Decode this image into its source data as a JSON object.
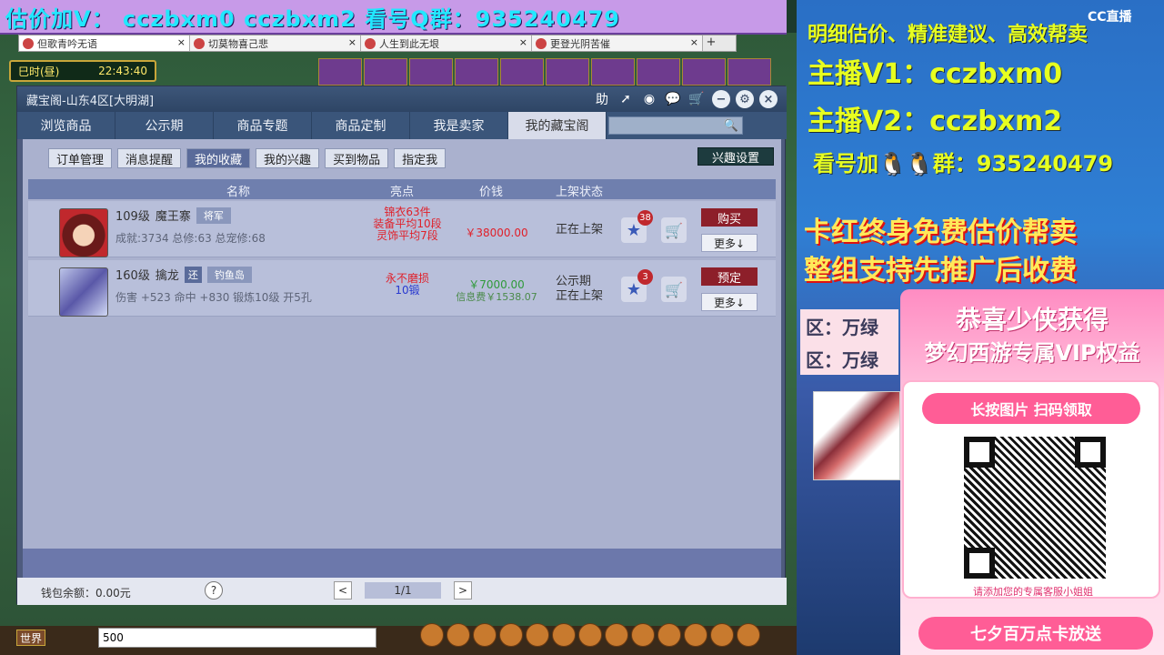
{
  "banner": {
    "text": "估价加V： cczbxm0  cczbxm2  看号Q群：935240479"
  },
  "game_tabs": [
    {
      "label": "但歌青吟无语"
    },
    {
      "label": "切莫物喜己悲"
    },
    {
      "label": "人生到此无垠"
    },
    {
      "label": "更登光阴苦催"
    }
  ],
  "add_tab": "+",
  "timebar": {
    "period": "巳时(昼)",
    "time": "22:43:40"
  },
  "window": {
    "title": "藏宝阁-山东4区[大明湖]",
    "help_label": "助",
    "nav_tabs": [
      "浏览商品",
      "公示期",
      "商品专题",
      "商品定制",
      "我是卖家",
      "我的藏宝阁"
    ],
    "sub_tabs": [
      "订单管理",
      "消息提醒",
      "我的收藏",
      "我的兴趣",
      "买到物品",
      "指定我"
    ],
    "interest_button": "兴趣设置",
    "columns": {
      "name": "名称",
      "highlights": "亮点",
      "price": "价钱",
      "status": "上架状态"
    },
    "rows": [
      {
        "level": "109级",
        "name": "魔王寨",
        "tag": "将军",
        "stats": "成就:3734 总修:63 总宠修:68",
        "highlights": [
          "锦衣63件",
          "装备平均10段",
          "灵饰平均7段"
        ],
        "price": "￥38000.00",
        "fee": "",
        "status": [
          "正在上架"
        ],
        "star_count": "38",
        "action": "购买",
        "more": "更多↓"
      },
      {
        "level": "160级",
        "name": "擒龙",
        "tag": "钓鱼岛",
        "small_tag": "还",
        "stats": "伤害 +523 命中 +830 锻炼10级 开5孔",
        "highlights": [
          "永不磨损",
          "10锻"
        ],
        "price": "￥7000.00",
        "fee": "信息费￥1538.07",
        "status": [
          "公示期",
          "正在上架"
        ],
        "star_count": "3",
        "action": "预定",
        "more": "更多↓"
      }
    ],
    "wallet": "钱包余额：0.00元",
    "help_q": "?",
    "page": "1/1",
    "prev": "<",
    "next": ">"
  },
  "chat": {
    "channel": "世界",
    "input_value": "500"
  },
  "side": {
    "line1": "明细估价、精准建议、高效帮卖",
    "line2": "主播V1：cczbxm0",
    "line3": "主播V2：cczbxm2",
    "line4": "看号加🐧🐧群：935240479",
    "promo1": "卡红终身免费估价帮卖",
    "promo2": "整组支持先推广后收费",
    "cc_logo": "CC直播",
    "ladder": [
      "区：万绿",
      "区：万绿"
    ],
    "vip_title1": "恭喜少侠获得",
    "vip_title2": "梦幻西游专属VIP权益",
    "vip_scan": "长按图片  扫码领取",
    "vip_note": "请添加您的专属客服小姐姐",
    "vip_bottom": "七夕百万点卡放送"
  },
  "colors": {
    "accent": "#3a557a",
    "buy": "#8d1f2a",
    "highlight": "#e0202a",
    "price": "#e0202a",
    "price_green": "#2f9a3a"
  }
}
